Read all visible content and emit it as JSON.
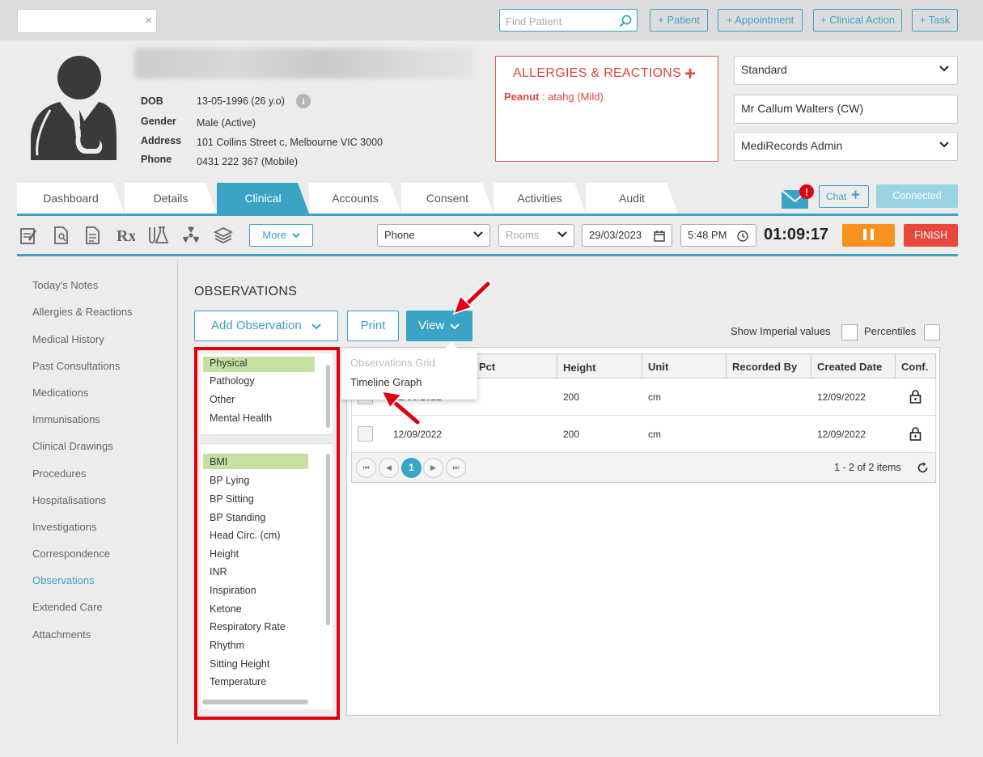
{
  "topbar": {
    "search_clear": "×",
    "find_patient_placeholder": "Find Patient",
    "buttons": [
      "+ Patient",
      "+ Appointment",
      "+ Clinical Action",
      "+ Task"
    ]
  },
  "patient": {
    "labels": {
      "dob": "DOB",
      "gender": "Gender",
      "address": "Address",
      "phone": "Phone"
    },
    "dob": "13-05-1996 (26 y.o)",
    "gender": "Male (Active)",
    "address": "101 Collins Street c, Melbourne VIC 3000",
    "phone": "0431 222 367 (Mobile)",
    "info_icon": "i"
  },
  "allergies": {
    "title": "ALLERGIES & REACTIONS",
    "add": "+",
    "item_name": "Peanut",
    "item_detail": " : atahg (Mild)"
  },
  "selectors": {
    "template": "Standard",
    "practitioner": "Mr Callum Walters (CW)",
    "role": "MediRecords Admin"
  },
  "tabs": [
    "Dashboard",
    "Details",
    "Clinical",
    "Accounts",
    "Consent",
    "Activities",
    "Audit"
  ],
  "active_tab": "Clinical",
  "header_right": {
    "mail_badge": "!",
    "chat": "Chat",
    "chat_plus": "+",
    "connected": "Connected"
  },
  "toolbar": {
    "more": "More",
    "contact_type": "Phone",
    "rooms_placeholder": "Rooms",
    "date": "29/03/2023",
    "time": "5:48 PM",
    "timer": "01:09:17",
    "finish": "FINISH"
  },
  "sidenav": [
    "Today's Notes",
    "Allergies & Reactions",
    "Medical History",
    "Past Consultations",
    "Medications",
    "Immunisations",
    "Clinical Drawings",
    "Procedures",
    "Hospitalisations",
    "Investigations",
    "Correspondence",
    "Observations",
    "Extended Care",
    "Attachments"
  ],
  "sidenav_active": "Observations",
  "observations": {
    "title": "OBSERVATIONS",
    "add_button": "Add Observation",
    "print_button": "Print",
    "view_button": "View",
    "show_imperial": "Show Imperial values",
    "percentiles": "Percentiles",
    "categories": [
      "Physical",
      "Pathology",
      "Other",
      "Mental Health"
    ],
    "types": [
      "BMI",
      "BP Lying",
      "BP Sitting",
      "BP Standing",
      "Head Circ. (cm)",
      "Height",
      "INR",
      "Inspiration",
      "Ketone",
      "Respiratory Rate",
      "Rhythm",
      "Sitting Height",
      "Temperature"
    ],
    "view_menu": [
      "Observations Grid",
      "Timeline Graph"
    ]
  },
  "grid": {
    "headers": {
      "pct": "Pct",
      "height": "Height",
      "unit": "Unit",
      "recorded_by": "Recorded By",
      "created": "Created Date",
      "conf": "Conf."
    },
    "rows": [
      {
        "date": "12/09/2022",
        "height": "200",
        "unit": "cm",
        "recorded_by": "",
        "created": "12/09/2022"
      },
      {
        "date": "12/09/2022",
        "height": "200",
        "unit": "cm",
        "recorded_by": "",
        "created": "12/09/2022"
      }
    ],
    "pager": {
      "first": "⏮",
      "prev": "◀",
      "current": "1",
      "next": "▶",
      "last": "⏭",
      "info": "1 - 2 of 2 items"
    }
  },
  "colors": {
    "accent": "#3aa3c6",
    "danger": "#e0453a",
    "warning": "#f7921e",
    "highlight": "#c6e0a2",
    "annotation": "#e0000d"
  }
}
